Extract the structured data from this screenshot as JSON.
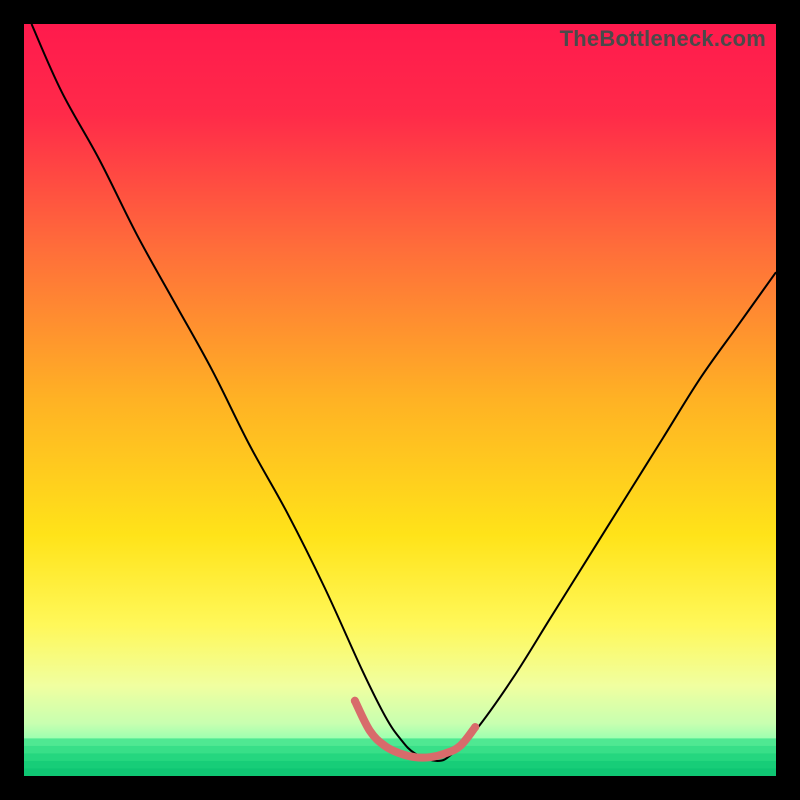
{
  "watermark": "TheBottleneck.com",
  "chart_data": {
    "type": "line",
    "title": "",
    "xlabel": "",
    "ylabel": "",
    "xlim": [
      0,
      100
    ],
    "ylim": [
      0,
      100
    ],
    "background_gradient": {
      "stops": [
        {
          "offset": 0.0,
          "color": "#ff1a4d"
        },
        {
          "offset": 0.12,
          "color": "#ff2a49"
        },
        {
          "offset": 0.3,
          "color": "#ff6e3a"
        },
        {
          "offset": 0.5,
          "color": "#ffb224"
        },
        {
          "offset": 0.68,
          "color": "#ffe319"
        },
        {
          "offset": 0.8,
          "color": "#fff85a"
        },
        {
          "offset": 0.88,
          "color": "#f0ffa0"
        },
        {
          "offset": 0.93,
          "color": "#c8ffb0"
        },
        {
          "offset": 0.965,
          "color": "#7dffb0"
        },
        {
          "offset": 1.0,
          "color": "#17e884"
        }
      ]
    },
    "series": [
      {
        "name": "bottleneck-curve",
        "color": "#000000",
        "width": 2,
        "x": [
          1,
          5,
          10,
          15,
          20,
          25,
          30,
          35,
          40,
          45,
          48,
          50,
          52,
          55,
          57,
          60,
          65,
          70,
          75,
          80,
          85,
          90,
          95,
          100
        ],
        "y": [
          100,
          91,
          82,
          72,
          63,
          54,
          44,
          35,
          25,
          14,
          8,
          5,
          3,
          2,
          3,
          6,
          13,
          21,
          29,
          37,
          45,
          53,
          60,
          67
        ]
      },
      {
        "name": "optimal-band",
        "color": "#d86b6b",
        "width": 8,
        "linecap": "round",
        "x": [
          44,
          46,
          48,
          50,
          52,
          54,
          56,
          58,
          60
        ],
        "y": [
          10,
          6,
          4,
          3,
          2.5,
          2.5,
          3,
          4,
          6.5
        ]
      }
    ],
    "bottom_stripes": {
      "y0": 95,
      "y1": 100,
      "colors": [
        "#4fe892",
        "#38df88",
        "#25d67f",
        "#17cd78",
        "#0fc673"
      ]
    }
  }
}
